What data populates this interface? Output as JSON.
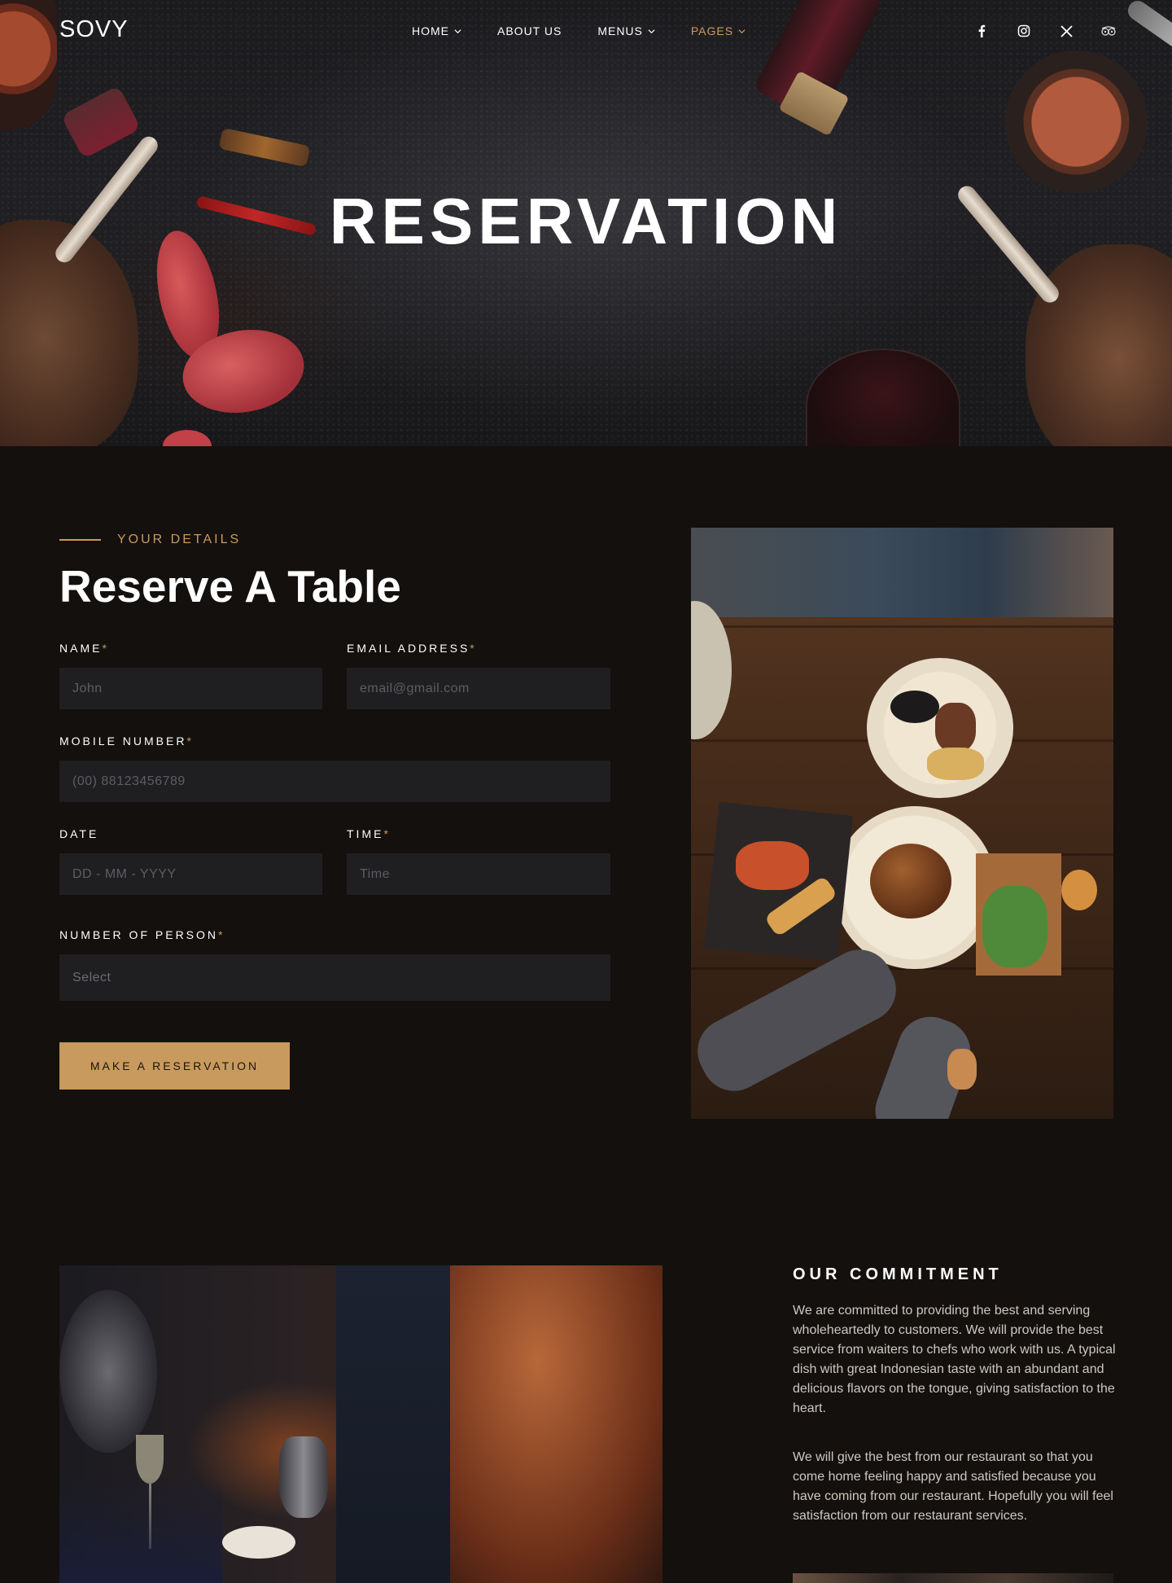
{
  "nav": {
    "logo": "SOVY",
    "items": [
      {
        "label": "HOME",
        "has_dropdown": true,
        "active": false
      },
      {
        "label": "ABOUT US",
        "has_dropdown": false,
        "active": false
      },
      {
        "label": "MENUS",
        "has_dropdown": true,
        "active": false
      },
      {
        "label": "PAGES",
        "has_dropdown": true,
        "active": true
      }
    ],
    "socials": [
      "facebook-icon",
      "instagram-icon",
      "x-icon",
      "tripadvisor-icon"
    ]
  },
  "hero": {
    "title": "RESERVATION"
  },
  "form": {
    "eyebrow": "YOUR DETAILS",
    "title": "Reserve A Table",
    "name_label": "NAME",
    "name_placeholder": "John",
    "email_label": "EMAIL ADDRESS",
    "email_placeholder": "email@gmail.com",
    "mobile_label": "MOBILE NUMBER",
    "mobile_placeholder": "(00) 88123456789",
    "date_label": "DATE",
    "date_placeholder": "DD - MM - YYYY",
    "time_label": "TIME",
    "time_placeholder": "Time",
    "persons_label": "NUMBER OF PERSON",
    "persons_selected": "Select",
    "required_mark": "*",
    "submit_label": "MAKE A RESERVATION"
  },
  "commitment": {
    "title": "OUR COMMITMENT",
    "paragraph_1": "We are committed to providing the best and serving wholeheartedly to customers. We will provide the best service from waiters to chefs who work with us. A typical dish with great Indonesian taste with an abundant and delicious flavors on the tongue, giving satisfaction to the heart.",
    "paragraph_2": "We will give the best from our restaurant so that you come home feeling happy and satisfied because you have coming from our restaurant. Hopefully you will feel satisfaction from our restaurant services."
  },
  "colors": {
    "background": "#13100e",
    "accent": "#c99a5d",
    "field_bg": "#1f1f22",
    "active_nav": "#d09b5a"
  }
}
